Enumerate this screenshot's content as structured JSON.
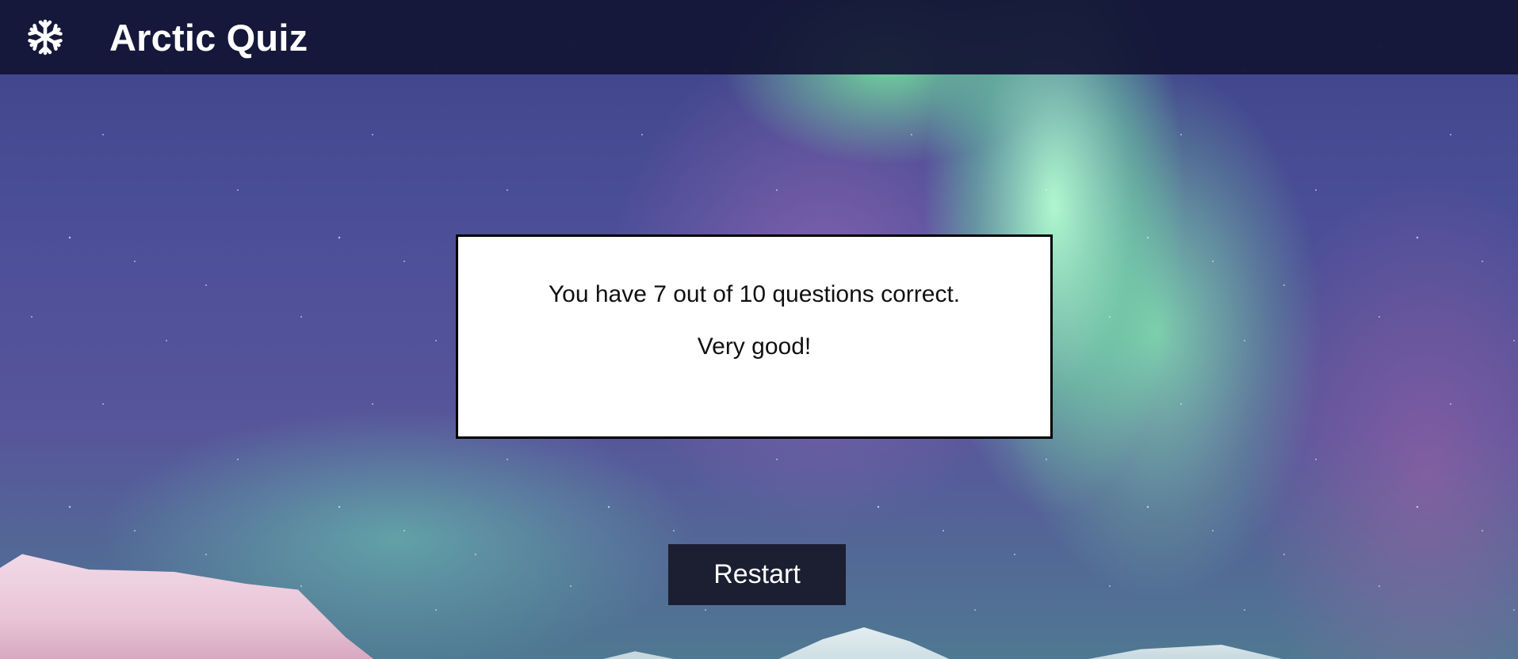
{
  "header": {
    "logo_icon": "snowflake-icon",
    "title": "Arctic Quiz",
    "background_color": "#121434"
  },
  "result": {
    "score_message": "You have 7 out of 10 questions correct.",
    "feedback": "Very good!"
  },
  "actions": {
    "restart_label": "Restart",
    "restart_color": "#1b1f31"
  },
  "background": {
    "description_icon": "aurora-background"
  }
}
